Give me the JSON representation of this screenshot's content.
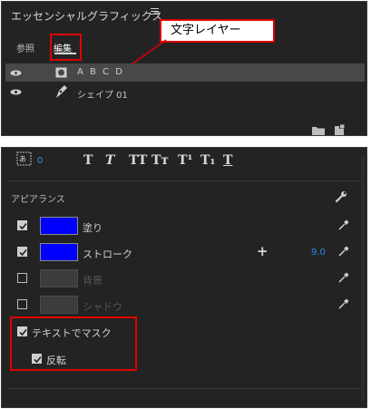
{
  "panel": {
    "title": "エッセンシャルグラフィックス",
    "tabs": [
      {
        "label": "参照",
        "active": false
      },
      {
        "label": "編集",
        "active": true
      }
    ],
    "callout": "文字レイヤー"
  },
  "layers": [
    {
      "name": "A B C D",
      "type": "text",
      "selected": true,
      "visible": true
    },
    {
      "name": "シェイプ 01",
      "type": "shape",
      "selected": false,
      "visible": true
    }
  ],
  "text_toolbar": {
    "leading_value": "0",
    "style_buttons": [
      "T",
      "T",
      "TT",
      "Tт",
      "T¹",
      "T₁",
      "T"
    ]
  },
  "appearance": {
    "section_label": "アピアランス",
    "rows": [
      {
        "label": "塗り",
        "checked": true,
        "color": "#0000ff",
        "enabled": true
      },
      {
        "label": "ストローク",
        "checked": true,
        "color": "#0000ff",
        "enabled": true,
        "value": "9.0",
        "add_symbol": "+"
      },
      {
        "label": "背景",
        "checked": false,
        "enabled": false
      },
      {
        "label": "シャドウ",
        "checked": false,
        "enabled": false
      }
    ],
    "mask": {
      "label": "テキストでマスク",
      "checked": true
    },
    "invert": {
      "label": "反転",
      "checked": true
    }
  },
  "colors": {
    "accent_blue": "#2d8ceb",
    "highlight_red": "#e00000",
    "fill_blue": "#0000ff",
    "panel_bg": "#232323"
  }
}
